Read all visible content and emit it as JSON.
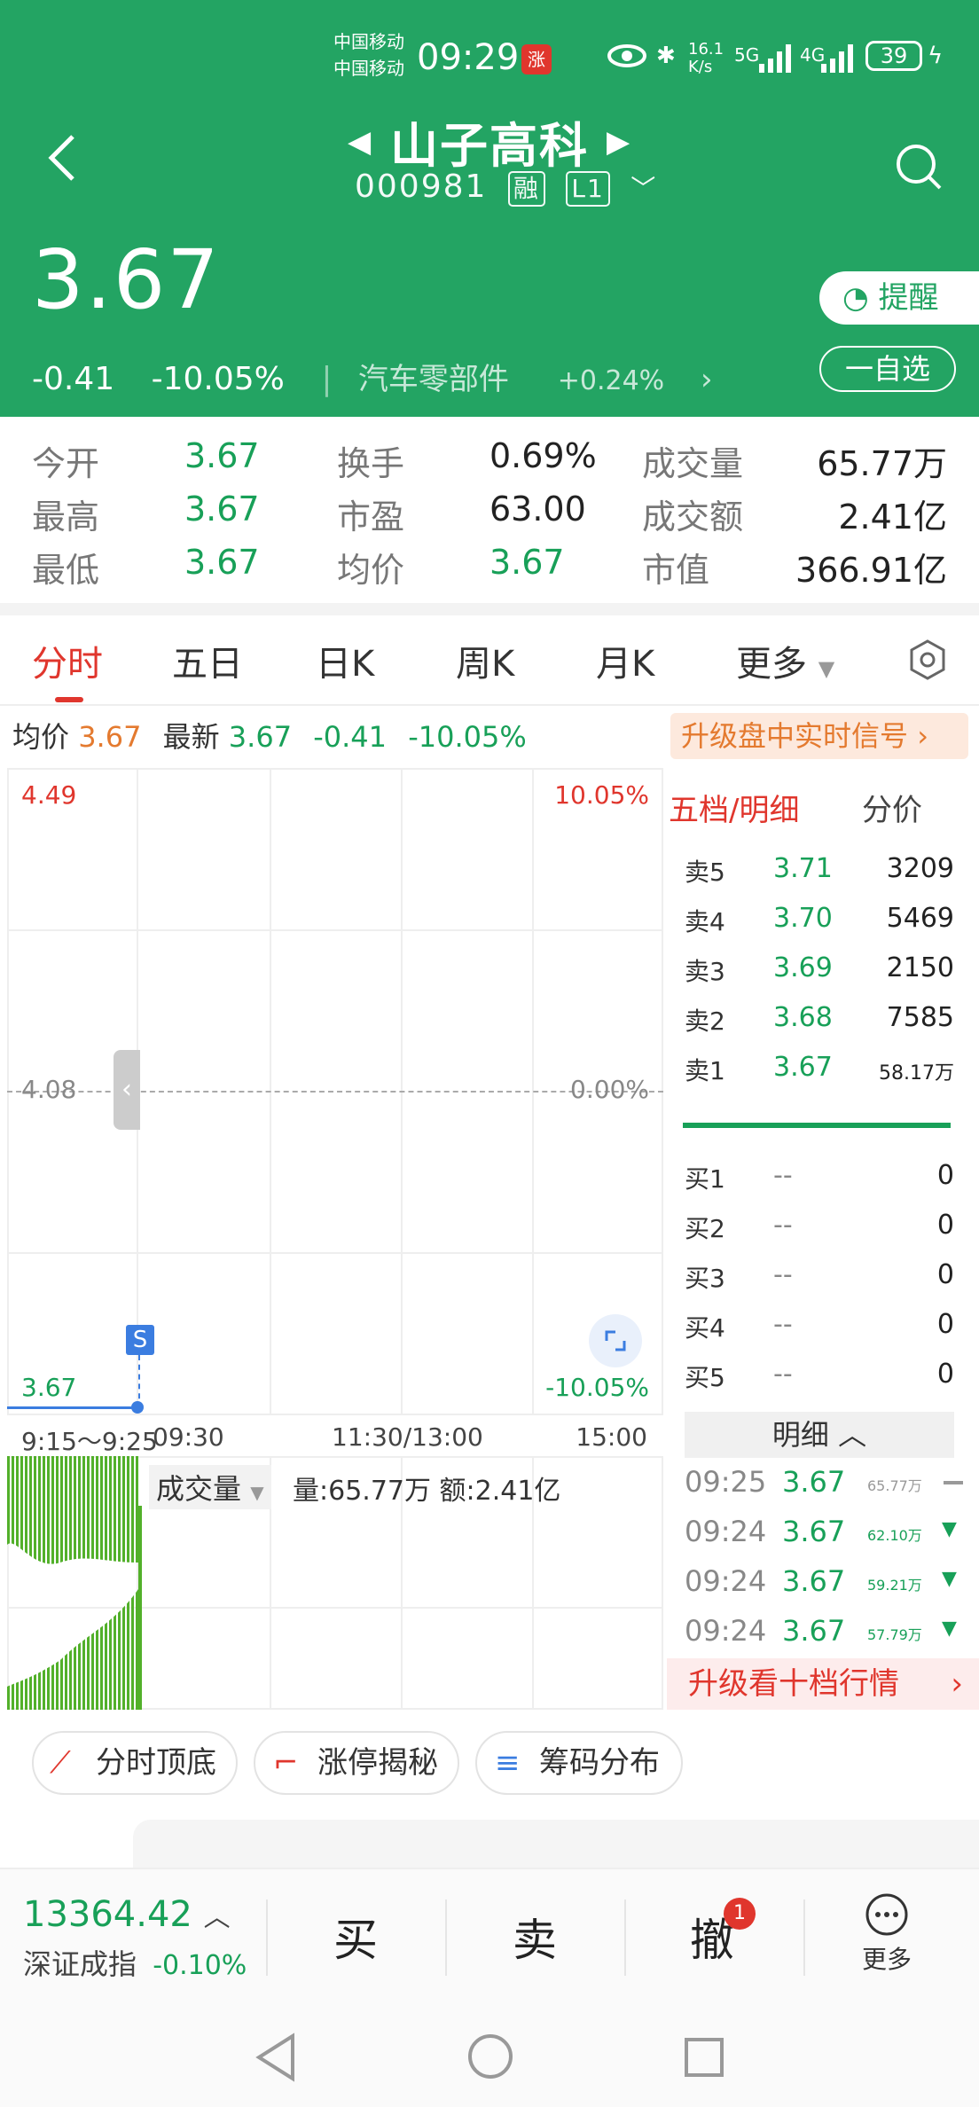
{
  "status_bar": {
    "carrier1": "中国移动",
    "carrier2": "中国移动",
    "time": "09:29",
    "speed": "16.1 K/s",
    "net1": "5G",
    "net2": "4G",
    "battery": "39"
  },
  "header": {
    "stock_name": "山子高科",
    "stock_code": "000981",
    "badge_margin": "融",
    "badge_level": "L1",
    "price": "3.67",
    "change": "-0.41",
    "change_pct": "-10.05%",
    "sector_name": "汽车零部件",
    "sector_pct": "+0.24%",
    "remind_label": "提醒",
    "watch_label": "一自选"
  },
  "stats": [
    {
      "label": "今开",
      "value": "3.67"
    },
    {
      "label": "换手",
      "value": "0.69%"
    },
    {
      "label": "成交量",
      "value": "65.77万"
    },
    {
      "label": "最高",
      "value": "3.67"
    },
    {
      "label": "市盈",
      "value": "63.00"
    },
    {
      "label": "成交额",
      "value": "2.41亿"
    },
    {
      "label": "最低",
      "value": "3.67"
    },
    {
      "label": "均价",
      "value": "3.67"
    },
    {
      "label": "市值",
      "value": "366.91亿"
    }
  ],
  "tabs": [
    "分时",
    "五日",
    "日K",
    "周K",
    "月K",
    "更多"
  ],
  "info_line": {
    "avg_label": "均价",
    "avg": "3.67",
    "latest_label": "最新",
    "latest": "3.67",
    "chg": "-0.41",
    "pct": "-10.05%",
    "upgrade": "升级盘中实时信号"
  },
  "chart": {
    "top_price": "4.49",
    "top_pct": "10.05%",
    "mid_price": "4.08",
    "mid_pct": "0.00%",
    "bottom_price": "3.67",
    "bottom_pct": "-10.05%",
    "s_mark": "S",
    "time_labels": [
      "9:15～9:25",
      "09:30",
      "11:30/13:00",
      "15:00"
    ],
    "volume_label": "成交量",
    "volume_info": "量:65.77万 额:2.41亿"
  },
  "order_book": {
    "tab_active": "五档/明细",
    "tab_other": "分价",
    "asks": [
      {
        "k": "卖5",
        "p": "3.71",
        "q": "3209"
      },
      {
        "k": "卖4",
        "p": "3.70",
        "q": "5469"
      },
      {
        "k": "卖3",
        "p": "3.69",
        "q": "2150"
      },
      {
        "k": "卖2",
        "p": "3.68",
        "q": "7585"
      },
      {
        "k": "卖1",
        "p": "3.67",
        "q": "58.17万"
      }
    ],
    "bids": [
      {
        "k": "买1",
        "p": "--",
        "q": "0"
      },
      {
        "k": "买2",
        "p": "--",
        "q": "0"
      },
      {
        "k": "买3",
        "p": "--",
        "q": "0"
      },
      {
        "k": "买4",
        "p": "--",
        "q": "0"
      },
      {
        "k": "买5",
        "p": "--",
        "q": "0"
      }
    ],
    "detail_label": "明细",
    "details": [
      {
        "t": "09:25",
        "p": "3.67",
        "v": "65.77万"
      },
      {
        "t": "09:24",
        "p": "3.67",
        "v": "62.10万"
      },
      {
        "t": "09:24",
        "p": "3.67",
        "v": "59.21万"
      },
      {
        "t": "09:24",
        "p": "3.67",
        "v": "57.79万"
      }
    ],
    "upgrade_ten": "升级看十档行情"
  },
  "features": [
    "分时顶底",
    "涨停揭秘",
    "筹码分布"
  ],
  "bottom_bar": {
    "index_value": "13364.42",
    "index_name": "深证成指",
    "index_pct": "-0.10%",
    "buy": "买",
    "sell": "卖",
    "cancel": "撤",
    "cancel_badge": "1",
    "more": "更多"
  },
  "colors": {
    "brand_green": "#23a463",
    "up_red": "#e0362d",
    "down_green": "#18a058"
  }
}
